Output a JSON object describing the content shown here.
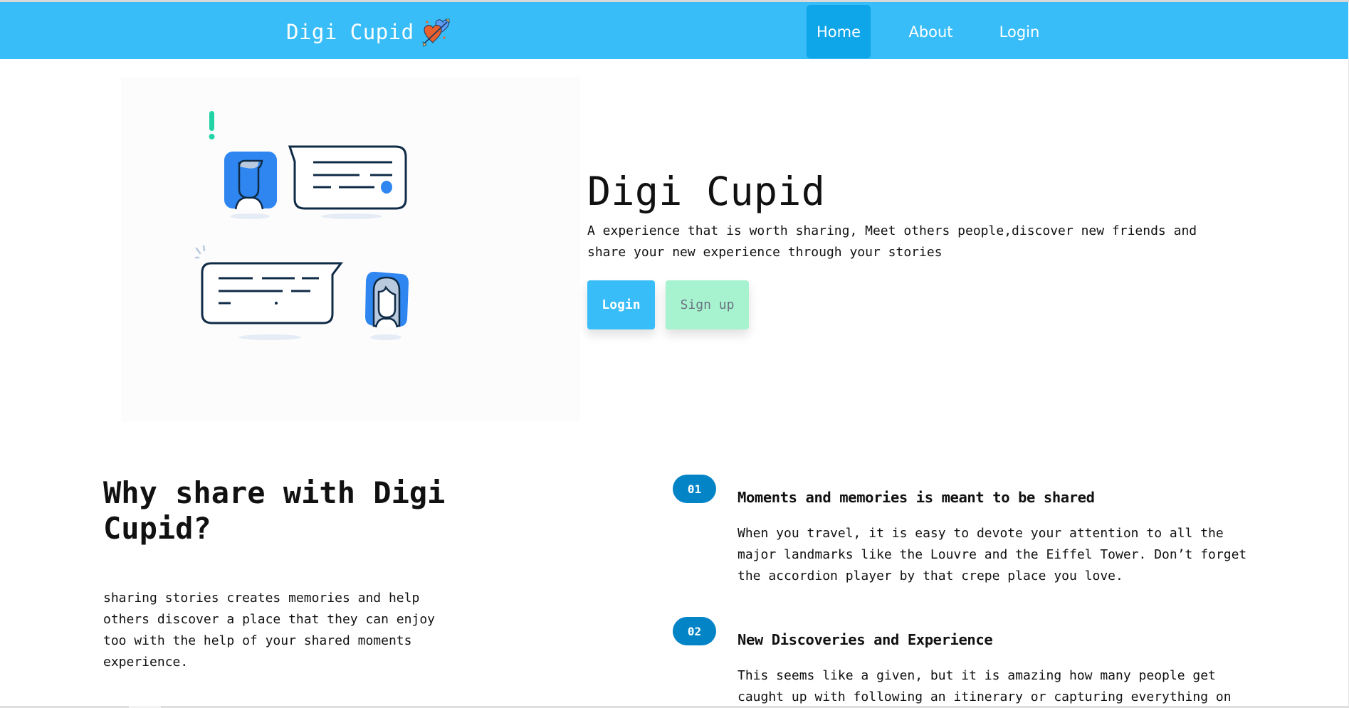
{
  "header": {
    "brand": "Digi Cupid",
    "brand_icon": "hearts-arrow-icon",
    "nav": [
      {
        "label": "Home",
        "active": true
      },
      {
        "label": "About",
        "active": false
      },
      {
        "label": "Login",
        "active": false
      }
    ]
  },
  "hero": {
    "illustration": "chat-bubbles-illustration",
    "title": "Digi Cupid",
    "subtitle": "A experience that is worth sharing, Meet others people,discover new friends and share your new experience through your stories",
    "login_label": "Login",
    "signup_label": "Sign up"
  },
  "why": {
    "title": "Why share with Digi Cupid?",
    "text": "sharing stories creates memories and help others discover a place that they can enjoy too with the help of your shared moments experience."
  },
  "features": [
    {
      "number": "01",
      "title": "Moments and memories is meant to be shared",
      "text": "When you travel, it is easy to devote your attention to all the major landmarks like the Louvre and the Eiffel Tower. Don’t forget the accordion player by that crepe place you love."
    },
    {
      "number": "02",
      "title": "New Discoveries and Experience",
      "text": "This seems like a given, but it is amazing how many people get caught up with following an itinerary or capturing everything on"
    }
  ],
  "colors": {
    "header": "#38bdf8",
    "nav_active": "#0ea5e9",
    "login_button": "#38bdf8",
    "signup_button": "#a7f3d0",
    "badge": "#0284c7",
    "avatar_blue": "#2f86f0",
    "accent_green": "#22d3a6",
    "outline_navy": "#0f2b46"
  }
}
